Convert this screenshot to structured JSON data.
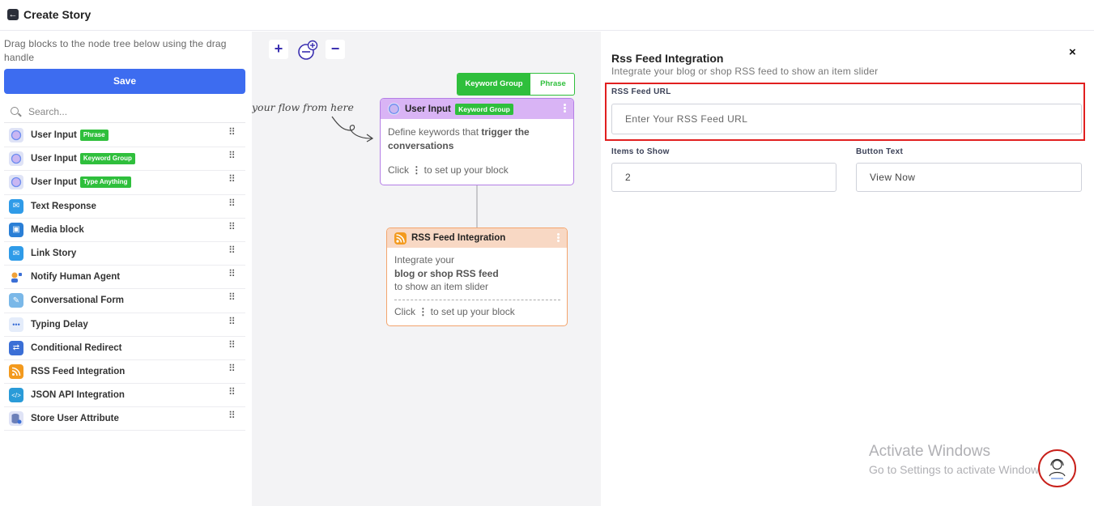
{
  "header": {
    "title": "Create Story"
  },
  "sidebar": {
    "hint": "Drag blocks to the node tree below using the drag handle",
    "save_label": "Save",
    "search_placeholder": "Search...",
    "items": [
      {
        "label": "User Input",
        "tag": "Phrase",
        "icon": "chat-bubble-icon"
      },
      {
        "label": "User Input",
        "tag": "Keyword Group",
        "icon": "chat-bubble-icon"
      },
      {
        "label": "User Input",
        "tag": "Type Anything",
        "icon": "chat-bubble-icon"
      },
      {
        "label": "Text Response",
        "tag": "",
        "icon": "envelope-icon"
      },
      {
        "label": "Media block",
        "tag": "",
        "icon": "media-icon"
      },
      {
        "label": "Link Story",
        "tag": "",
        "icon": "envelope-icon"
      },
      {
        "label": "Notify Human Agent",
        "tag": "",
        "icon": "agent-icon"
      },
      {
        "label": "Conversational Form",
        "tag": "",
        "icon": "form-icon"
      },
      {
        "label": "Typing Delay",
        "tag": "",
        "icon": "dots-icon"
      },
      {
        "label": "Conditional Redirect",
        "tag": "",
        "icon": "shuffle-icon"
      },
      {
        "label": "RSS Feed Integration",
        "tag": "",
        "icon": "rss-icon"
      },
      {
        "label": "JSON API Integration",
        "tag": "",
        "icon": "code-icon"
      },
      {
        "label": "Store User Attribute",
        "tag": "",
        "icon": "database-icon"
      }
    ]
  },
  "canvas": {
    "zoom_in": "+",
    "zoom_out": "−",
    "toggle": {
      "active": "Keyword Group",
      "inactive": "Phrase"
    },
    "flow_hint": "your flow from here",
    "node_user_input": {
      "title": "User Input",
      "tag": "Keyword Group",
      "text_pre": "Define keywords that ",
      "text_bold": "trigger the conversations",
      "click_pre": "Click ",
      "click_post": " to set up your block"
    },
    "node_rss": {
      "title": "RSS Feed Integration",
      "line1": "Integrate your",
      "line2": "blog or shop RSS feed",
      "line3": "to show an item slider",
      "click_pre": "Click ",
      "click_post": " to set up your block"
    }
  },
  "panel": {
    "title": "Rss Feed Integration",
    "subtitle": "Integrate your blog or shop RSS feed to show an item slider",
    "url_label": "RSS Feed URL",
    "url_placeholder": "Enter Your RSS Feed URL",
    "items_label": "Items to Show",
    "items_value": "2",
    "button_text_label": "Button Text",
    "button_text_value": "View Now",
    "close": "×"
  },
  "watermark": {
    "line1": "Activate Windows",
    "line2": "Go to Settings to activate Windows."
  },
  "colors": {
    "accent": "#3d6cf0",
    "tag_green": "#2fbf3c",
    "user_input_head": "#d9b4f5",
    "rss_head": "#f8d8c4",
    "highlight": "#e11f1f"
  }
}
